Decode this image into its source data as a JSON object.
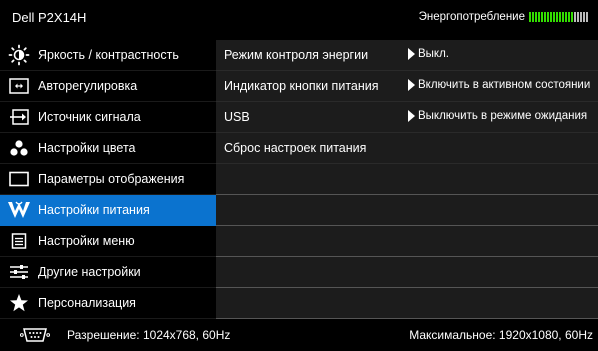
{
  "header": {
    "model": "Dell P2X14H",
    "energy_label": "Энергопотребление",
    "energy_level": 0.75,
    "colors": {
      "energy_on": "#33dd00",
      "energy_off": "#bbbbbb"
    }
  },
  "sidebar": {
    "items": [
      {
        "label": "Яркость / контрастность",
        "icon": "brightness-icon"
      },
      {
        "label": "Авторегулировка",
        "icon": "auto-adjust-icon"
      },
      {
        "label": "Источник сигнала",
        "icon": "input-source-icon"
      },
      {
        "label": "Настройки цвета",
        "icon": "color-dots-icon"
      },
      {
        "label": "Параметры отображения",
        "icon": "display-rect-icon"
      },
      {
        "label": "Настройки питания",
        "icon": "power-icon",
        "selected": true
      },
      {
        "label": "Настройки меню",
        "icon": "menu-icon"
      },
      {
        "label": "Другие настройки",
        "icon": "other-settings-icon"
      },
      {
        "label": "Персонализация",
        "icon": "star-icon"
      }
    ],
    "active_color": "#0b73cf"
  },
  "main": {
    "rows": [
      {
        "name": "Режим контроля энергии",
        "value": "Выкл."
      },
      {
        "name": "Индикатор кнопки питания",
        "value": "Включить в активном состоянии"
      },
      {
        "name": "USB",
        "value": "Выключить в режиме ожидания"
      },
      {
        "name": "Сброс настроек питания",
        "value": ""
      },
      {
        "name": "",
        "value": ""
      },
      {
        "name": "",
        "value": ""
      },
      {
        "name": "",
        "value": ""
      },
      {
        "name": "",
        "value": ""
      },
      {
        "name": "",
        "value": ""
      }
    ]
  },
  "footer": {
    "resolution": "Разрешение: 1024x768, 60Hz",
    "maximum": "Максимальное: 1920x1080, 60Hz",
    "icon": "vga-connector-icon"
  }
}
